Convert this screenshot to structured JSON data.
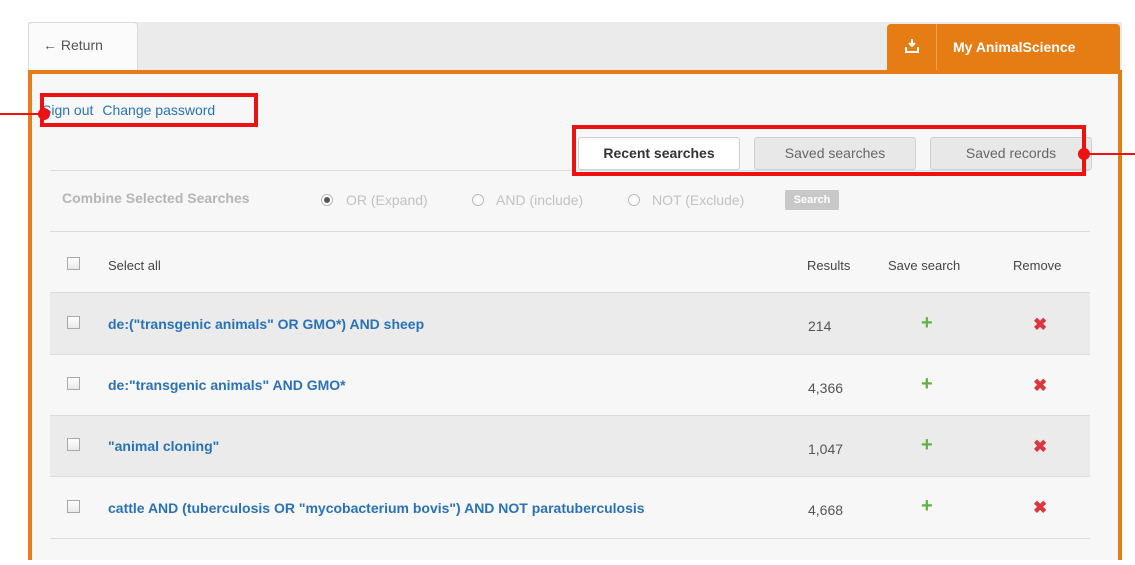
{
  "nav": {
    "return_label": "← Return",
    "my_account_label": "My AnimalScience"
  },
  "account_links": {
    "sign_out": "Sign out",
    "change_password": "Change password"
  },
  "tabs": [
    {
      "label": "Recent searches",
      "active": true
    },
    {
      "label": "Saved searches",
      "active": false
    },
    {
      "label": "Saved records",
      "active": false
    }
  ],
  "combine": {
    "title": "Combine Selected Searches",
    "options": [
      {
        "label": "OR (Expand)",
        "selected": true
      },
      {
        "label": "AND (include)",
        "selected": false
      },
      {
        "label": "NOT (Exclude)",
        "selected": false
      }
    ],
    "button": "Search"
  },
  "table": {
    "headers": {
      "select_all": "Select all",
      "results": "Results",
      "save_search": "Save search",
      "remove": "Remove"
    },
    "rows": [
      {
        "query": "de:(\"transgenic animals\" OR GMO*) AND sheep",
        "results": "214"
      },
      {
        "query": "de:\"transgenic animals\" AND GMO*",
        "results": "4,366"
      },
      {
        "query": "\"animal cloning\"",
        "results": "1,047"
      },
      {
        "query": "cattle AND (tuberculosis OR \"mycobacterium bovis\") AND NOT paratuberculosis",
        "results": "4,668"
      }
    ]
  },
  "icons": {
    "save": "plus-icon",
    "remove": "x-icon",
    "account": "logout-icon"
  },
  "colors": {
    "accent": "#e67d14",
    "link": "#2a72b8",
    "highlight": "#ee1111",
    "add": "#5fb342",
    "remove": "#d9363e"
  }
}
